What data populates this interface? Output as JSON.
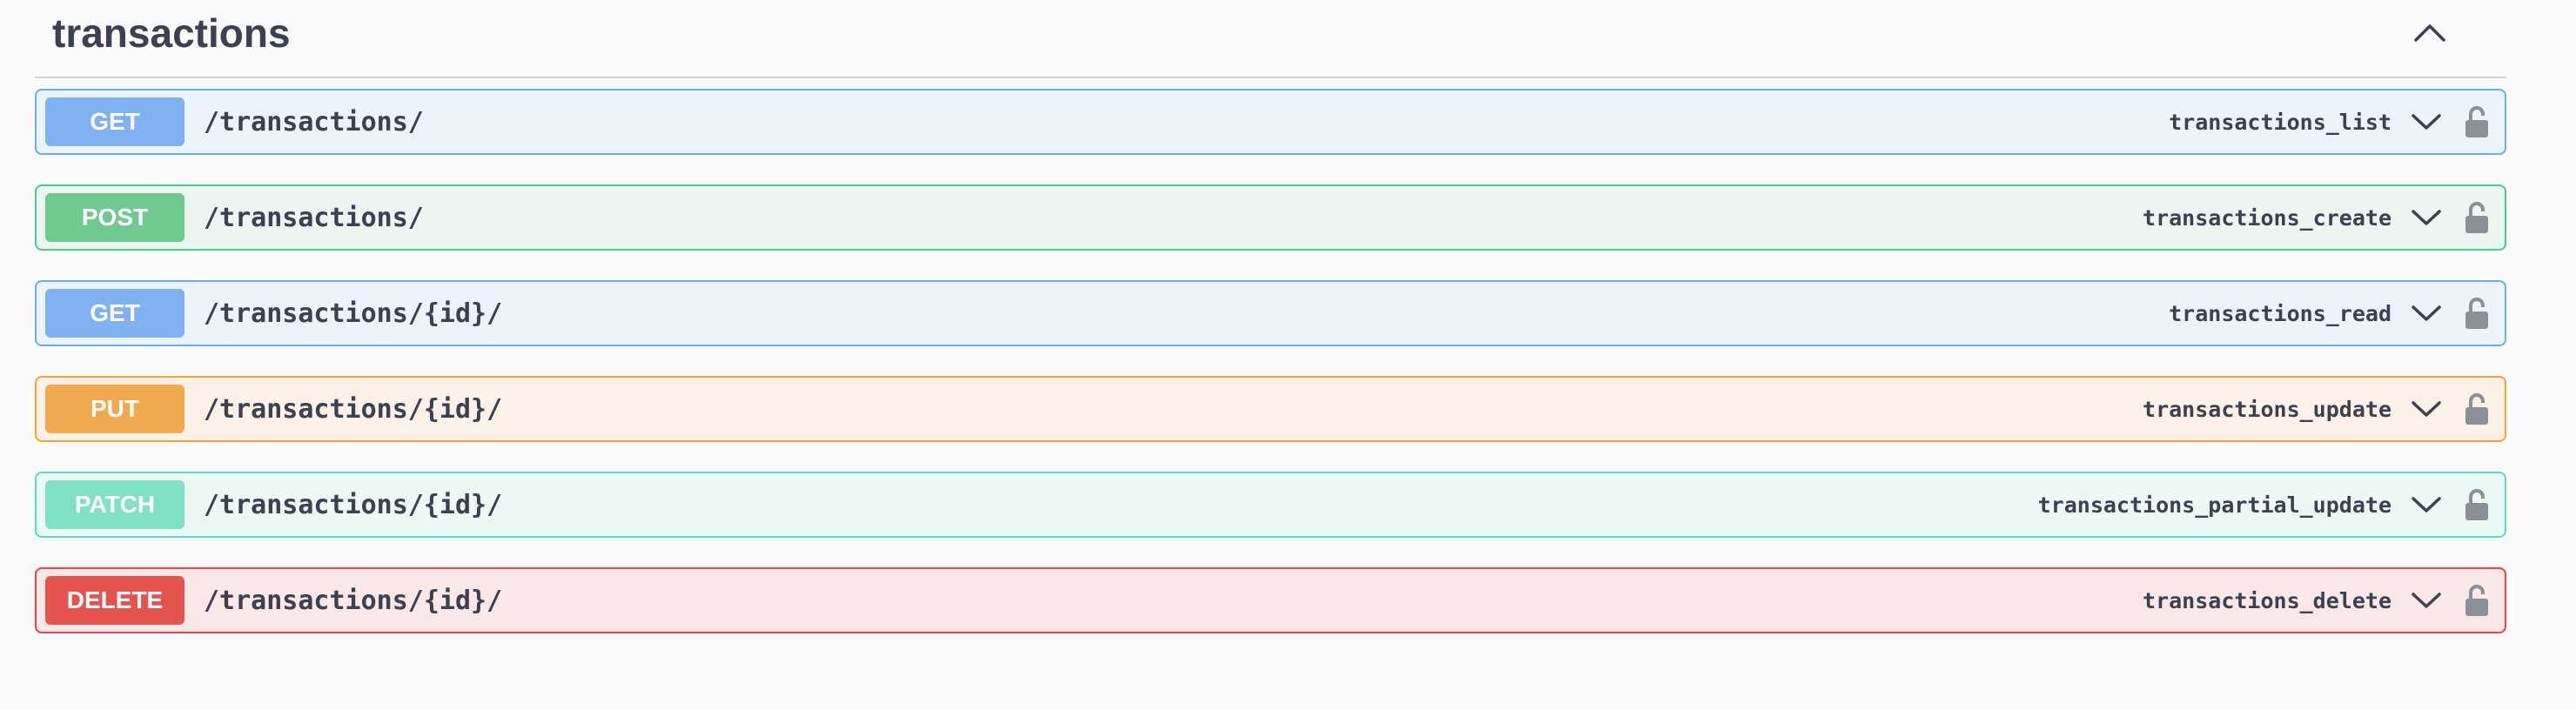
{
  "section": {
    "title": "transactions",
    "toggle_icon": "chevron-up-icon"
  },
  "operations": [
    {
      "method": "GET",
      "path": "/transactions/",
      "operation_id": "transactions_list",
      "color": "#61affe"
    },
    {
      "method": "POST",
      "path": "/transactions/",
      "operation_id": "transactions_create",
      "color": "#49cc90"
    },
    {
      "method": "GET",
      "path": "/transactions/{id}/",
      "operation_id": "transactions_read",
      "color": "#61affe"
    },
    {
      "method": "PUT",
      "path": "/transactions/{id}/",
      "operation_id": "transactions_update",
      "color": "#fca130"
    },
    {
      "method": "PATCH",
      "path": "/transactions/{id}/",
      "operation_id": "transactions_partial_update",
      "color": "#50e3c2"
    },
    {
      "method": "DELETE",
      "path": "/transactions/{id}/",
      "operation_id": "transactions_delete",
      "color": "#f93e3e"
    }
  ],
  "icons": {
    "expand": "chevron-down-icon",
    "auth": "lock-icon"
  }
}
